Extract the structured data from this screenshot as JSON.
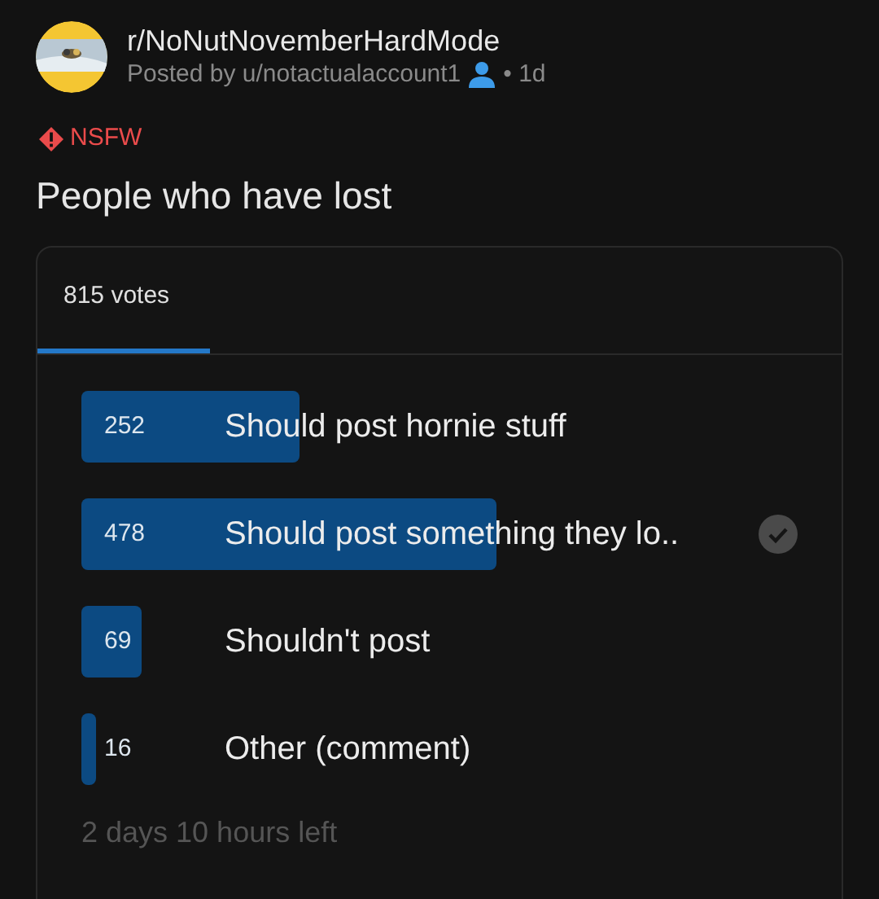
{
  "post": {
    "subreddit": "r/NoNutNovemberHardMode",
    "posted_by": "Posted by u/notactualaccount1",
    "age": "• 1d",
    "nsfw_label": "NSFW",
    "title": "People who have lost"
  },
  "poll": {
    "tab": "815 votes",
    "options": [
      {
        "count": "252",
        "label": "Should post hornie stuff",
        "level": 0.309,
        "selected": false
      },
      {
        "count": "478",
        "label": "Should post something they lo..",
        "level": 0.587,
        "selected": true
      },
      {
        "count": "69",
        "label": "Shouldn't post",
        "level": 0.085,
        "selected": false
      },
      {
        "count": "16",
        "label": "Other (comment)",
        "level": 0.02,
        "selected": false
      }
    ],
    "time_left": "2 days 10 hours left"
  }
}
